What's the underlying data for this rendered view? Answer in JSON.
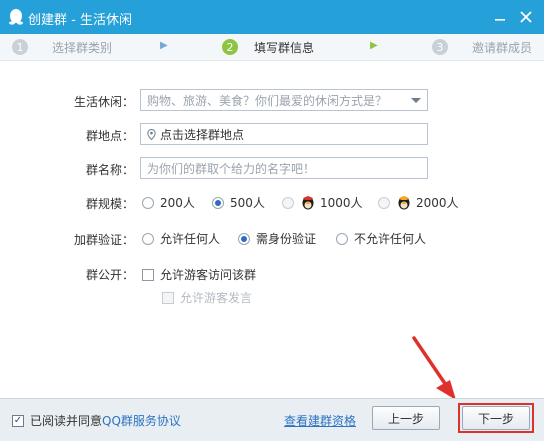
{
  "window": {
    "title": "创建群 - 生活休闲"
  },
  "steps": [
    {
      "num": "1",
      "label": "选择群类别"
    },
    {
      "num": "2",
      "label": "填写群信息"
    },
    {
      "num": "3",
      "label": "邀请群成员"
    }
  ],
  "form": {
    "category": {
      "label": "生活休闲：",
      "placeholder": "购物、旅游、美食？你们最爱的休闲方式是？"
    },
    "location": {
      "label": "群地点：",
      "placeholder": "点击选择群地点"
    },
    "name": {
      "label": "群名称：",
      "placeholder": "为你们的群取个给力的名字吧！"
    },
    "size": {
      "label": "群规模：",
      "options": [
        "200人",
        "500人",
        "1000人",
        "2000人"
      ],
      "selected": "500人"
    },
    "verify": {
      "label": "加群验证：",
      "options": [
        "允许任何人",
        "需身份验证",
        "不允许任何人"
      ],
      "selected": "需身份验证"
    },
    "public": {
      "label": "群公开：",
      "allow_visitors": "允许游客访问该群",
      "allow_visitor_posts": "允许游客发言"
    }
  },
  "footer": {
    "agree_text": "已阅读并同意",
    "agreement_link": "QQ群服务协议",
    "view_qualification": "查看建群资格",
    "prev_button": "上一步",
    "next_button": "下一步"
  },
  "colors": {
    "titlebar": "#25a0d8",
    "step_active": "#8dc540",
    "highlight": "#e0302b"
  }
}
